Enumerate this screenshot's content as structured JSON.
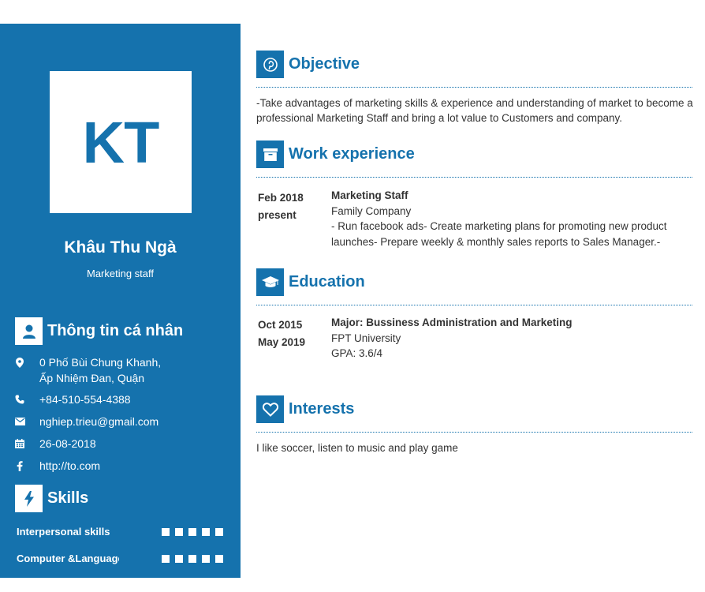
{
  "profile": {
    "initials": "KT",
    "name": "Khâu Thu Ngà",
    "title": "Marketing staff"
  },
  "personal": {
    "heading": "Thông tin cá nhân",
    "address_line1": "0 Phố Bùi Chung Khanh,",
    "address_line2": "Ấp Nhiệm Đan, Quận",
    "phone": "+84-510-554-4388",
    "email": "nghiep.trieu@gmail.com",
    "dob": "26-08-2018",
    "website": "http://to.com"
  },
  "skills": {
    "heading": "Skills",
    "items": [
      {
        "name": "Interpersonal skills",
        "level": 5,
        "max": 5
      },
      {
        "name": "Computer &Language",
        "level": 5,
        "max": 5
      }
    ]
  },
  "objective": {
    "heading": "Objective",
    "text": "-Take advantages of marketing skills & experience and understanding of market to become a professional Marketing Staff and bring a lot value to Customers and company."
  },
  "work": {
    "heading": "Work experience",
    "items": [
      {
        "date_from": "Feb 2018",
        "date_to": "present",
        "position": "Marketing Staff",
        "company": "Family Company",
        "description": "- Run facebook ads- Create marketing plans for promoting new product launches- Prepare weekly & monthly sales reports to Sales Manager.-"
      }
    ]
  },
  "education": {
    "heading": "Education",
    "items": [
      {
        "date_from": "Oct 2015",
        "date_to": "May 2019",
        "major": "Major: Bussiness Administration and Marketing",
        "school": "FPT University",
        "gpa": "GPA: 3.6/4"
      }
    ]
  },
  "interests": {
    "heading": "Interests",
    "text": "I like soccer, listen to music and play game"
  },
  "colors": {
    "accent": "#1572ad",
    "text": "#333333"
  }
}
